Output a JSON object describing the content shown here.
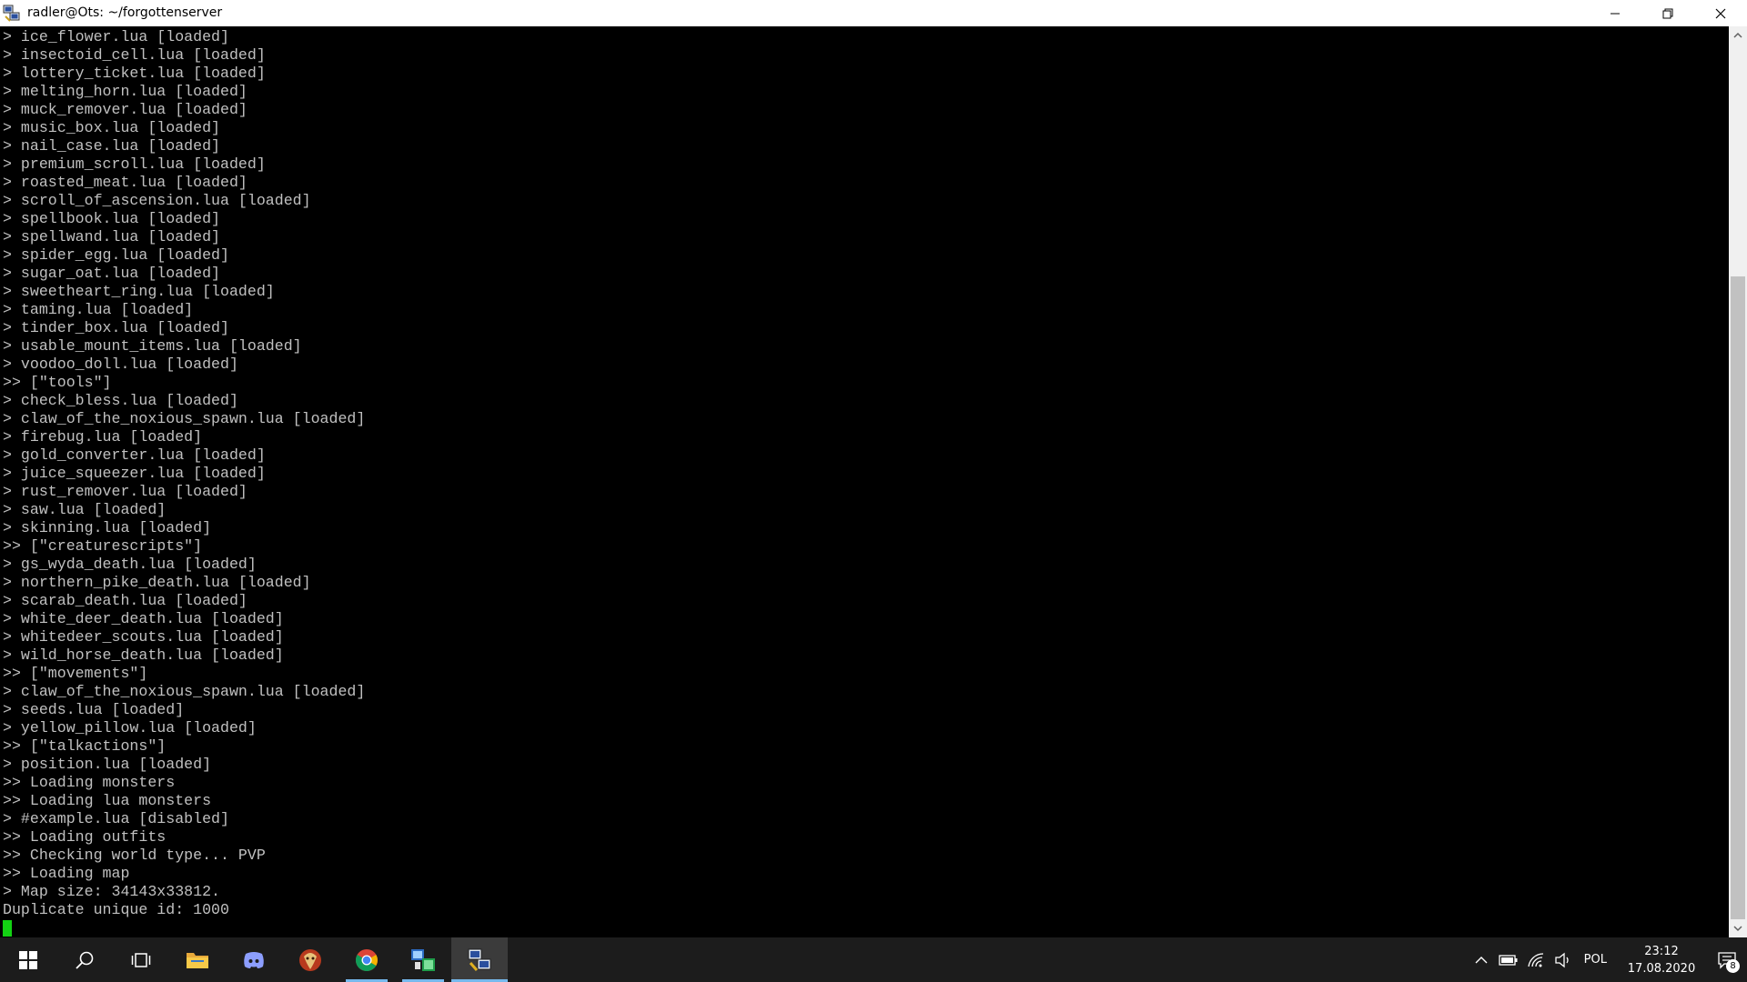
{
  "window": {
    "title": "radler@Ots: ~/forgottenserver"
  },
  "terminal": {
    "lines": [
      "> ice_flower.lua [loaded]",
      "> insectoid_cell.lua [loaded]",
      "> lottery_ticket.lua [loaded]",
      "> melting_horn.lua [loaded]",
      "> muck_remover.lua [loaded]",
      "> music_box.lua [loaded]",
      "> nail_case.lua [loaded]",
      "> premium_scroll.lua [loaded]",
      "> roasted_meat.lua [loaded]",
      "> scroll_of_ascension.lua [loaded]",
      "> spellbook.lua [loaded]",
      "> spellwand.lua [loaded]",
      "> spider_egg.lua [loaded]",
      "> sugar_oat.lua [loaded]",
      "> sweetheart_ring.lua [loaded]",
      "> taming.lua [loaded]",
      "> tinder_box.lua [loaded]",
      "> usable_mount_items.lua [loaded]",
      "> voodoo_doll.lua [loaded]",
      ">> [\"tools\"]",
      "> check_bless.lua [loaded]",
      "> claw_of_the_noxious_spawn.lua [loaded]",
      "> firebug.lua [loaded]",
      "> gold_converter.lua [loaded]",
      "> juice_squeezer.lua [loaded]",
      "> rust_remover.lua [loaded]",
      "> saw.lua [loaded]",
      "> skinning.lua [loaded]",
      ">> [\"creaturescripts\"]",
      "> gs_wyda_death.lua [loaded]",
      "> northern_pike_death.lua [loaded]",
      "> scarab_death.lua [loaded]",
      "> white_deer_death.lua [loaded]",
      "> whitedeer_scouts.lua [loaded]",
      "> wild_horse_death.lua [loaded]",
      ">> [\"movements\"]",
      "> claw_of_the_noxious_spawn.lua [loaded]",
      "> seeds.lua [loaded]",
      "> yellow_pillow.lua [loaded]",
      ">> [\"talkactions\"]",
      "> position.lua [loaded]",
      ">> Loading monsters",
      ">> Loading lua monsters",
      "> #example.lua [disabled]",
      ">> Loading outfits",
      ">> Checking world type... PVP",
      ">> Loading map",
      "> Map size: 34143x33812.",
      "Duplicate unique id: 1000"
    ],
    "text_color": "#c0c0c0",
    "cursor_color": "#13d213"
  },
  "taskbar": {
    "apps": [
      {
        "icon": "windows-start-icon"
      },
      {
        "icon": "search-icon"
      },
      {
        "icon": "task-view-icon"
      },
      {
        "icon": "file-explorer-icon"
      },
      {
        "icon": "discord-icon"
      },
      {
        "icon": "game-app-icon"
      },
      {
        "icon": "chrome-icon"
      },
      {
        "icon": "server-app-icon"
      },
      {
        "icon": "putty-icon"
      }
    ],
    "tray": {
      "language": "POL",
      "time": "23:12",
      "date": "17.08.2020",
      "notification_count": "8"
    }
  }
}
